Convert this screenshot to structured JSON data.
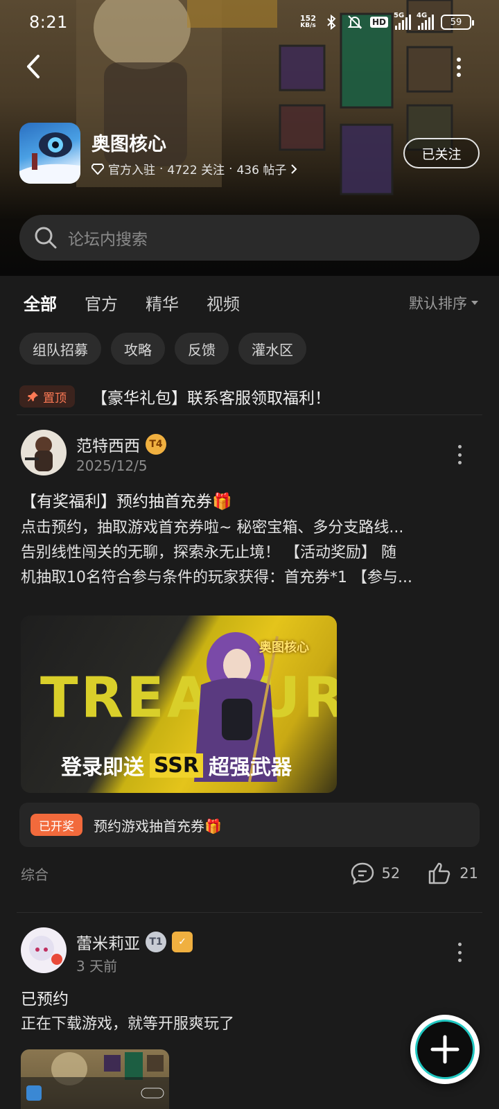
{
  "status_bar": {
    "time": "8:21",
    "net_speed_value": "152",
    "net_speed_unit": "KB/s",
    "hd_label": "HD",
    "sig1_label": "5G",
    "sig2_label": "4G",
    "battery": "59"
  },
  "game": {
    "title": "奥图核心",
    "official_label": "官方入驻",
    "followers": "4722 关注",
    "posts": "436 帖子",
    "follow_button": "已关注"
  },
  "search": {
    "placeholder": "论坛内搜索"
  },
  "tabs": [
    {
      "label": "全部"
    },
    {
      "label": "官方"
    },
    {
      "label": "精华"
    },
    {
      "label": "视频"
    }
  ],
  "sort_label": "默认排序",
  "chips": [
    {
      "label": "组队招募"
    },
    {
      "label": "攻略"
    },
    {
      "label": "反馈"
    },
    {
      "label": "灌水区"
    }
  ],
  "pinned": {
    "tag": "置顶",
    "text": "【豪华礼包】联系客服领取福利！"
  },
  "posts": [
    {
      "author": "范特西西",
      "author_badge": "T4",
      "date": "2025/12/5",
      "title": "【有奖福利】预约抽首充券🎁",
      "body_lines": [
        "点击预约，抽取游戏首充券啦~ 秘密宝箱、多分支路线...",
        "告别线性闯关的无聊，探索永无止境！ 【活动奖励】 随",
        "机抽取10名符合参与条件的玩家获得：首充券*1 【参与..."
      ],
      "banner": {
        "big": "TREASURE",
        "logo": "奥图核心",
        "sub_pre": "登录即送",
        "sub_ssr": "SSR",
        "sub_post": "超强武器"
      },
      "lottery": {
        "tag": "已开奖",
        "text": "预约游戏抽首充券🎁"
      },
      "category": "综合",
      "comments": "52",
      "likes": "21"
    },
    {
      "author": "蕾米莉亚",
      "author_badge": "T1",
      "date": "3 天前",
      "title": "已预约",
      "body_lines": [
        "正在下载游戏，就等开服爽玩了"
      ]
    }
  ]
}
